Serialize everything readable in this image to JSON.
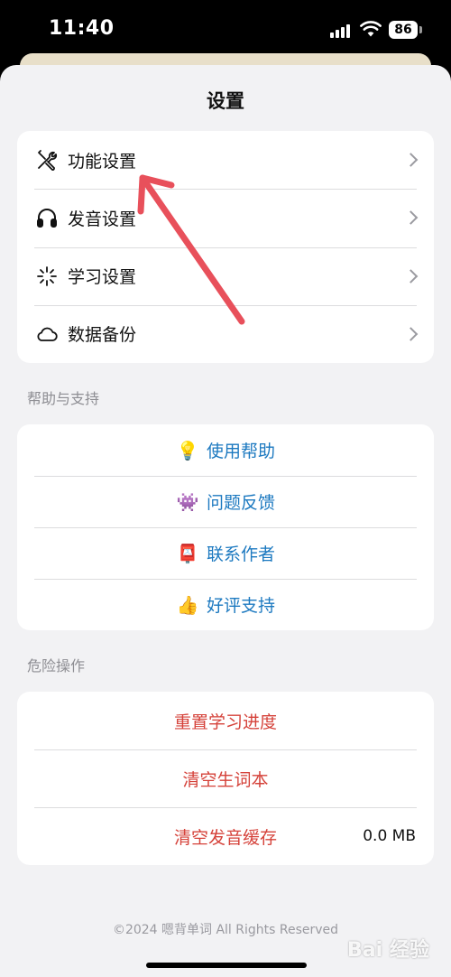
{
  "status_bar": {
    "time": "11:40",
    "battery": "86"
  },
  "sheet": {
    "title": "设置"
  },
  "settings": [
    {
      "label": "功能设置",
      "icon": "tools-icon"
    },
    {
      "label": "发音设置",
      "icon": "headphones-icon"
    },
    {
      "label": "学习设置",
      "icon": "sparkle-icon"
    },
    {
      "label": "数据备份",
      "icon": "cloud-icon"
    }
  ],
  "help": {
    "section_label": "帮助与支持",
    "items": [
      {
        "label": "使用帮助",
        "emoji": "💡",
        "icon": "lightbulb-icon"
      },
      {
        "label": "问题反馈",
        "emoji": "👾",
        "icon": "alien-monster-icon"
      },
      {
        "label": "联系作者",
        "emoji": "📮",
        "icon": "postbox-icon"
      },
      {
        "label": "好评支持",
        "emoji": "👍",
        "icon": "thumbs-up-icon"
      }
    ]
  },
  "danger": {
    "section_label": "危险操作",
    "items": [
      {
        "label": "重置学习进度"
      },
      {
        "label": "清空生词本"
      },
      {
        "label": "清空发音缓存",
        "value": "0.0 MB"
      }
    ]
  },
  "footer": "©2024 嗯背单词 All Rights Reserved",
  "watermark": "Bai 经验",
  "colors": {
    "link_blue": "#1c79c0",
    "danger_red": "#d5423a",
    "annotation_arrow": "#e8505b"
  }
}
